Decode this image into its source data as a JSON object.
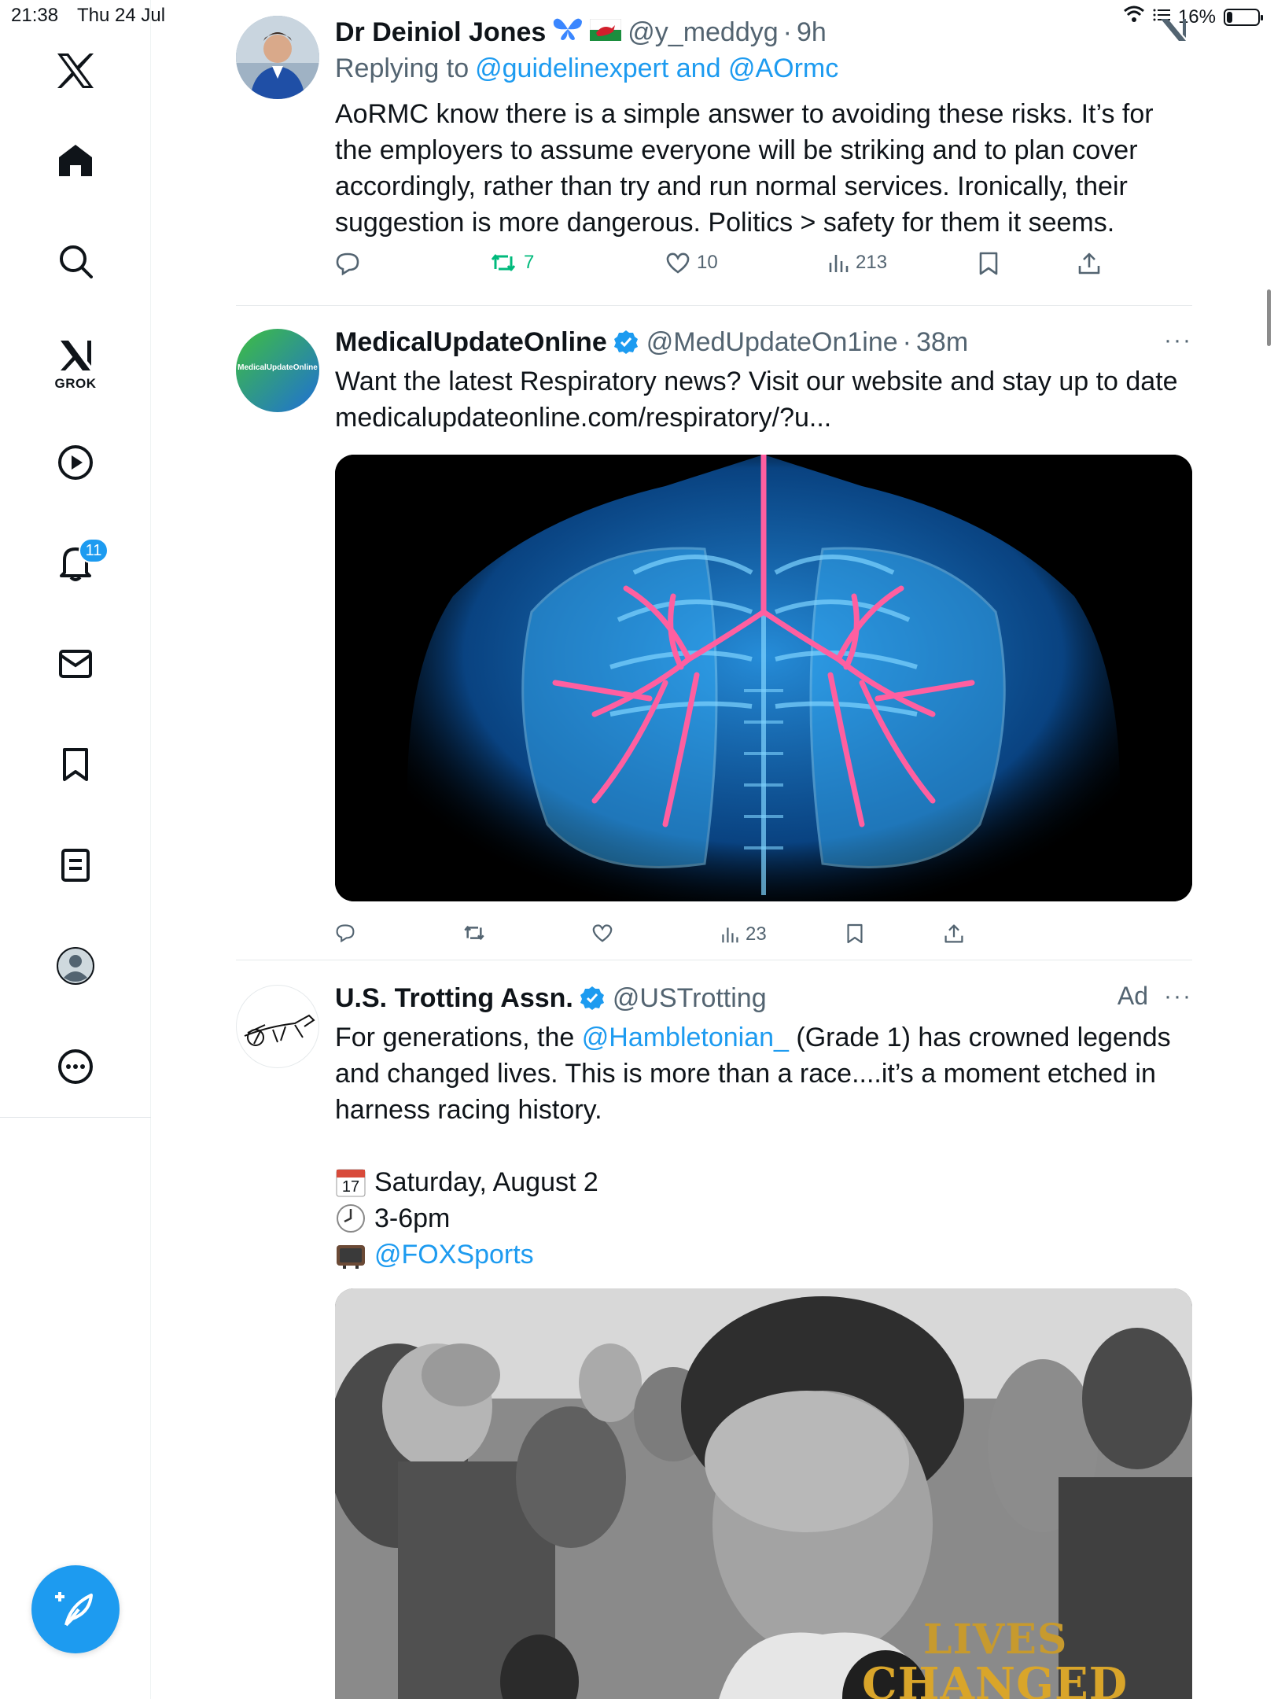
{
  "status_bar": {
    "time": "21:38",
    "date": "Thu 24 Jul",
    "battery": "16%",
    "battery_level": 0.16
  },
  "sidebar": {
    "grok_label": "GROK",
    "notification_count": "11",
    "items": [
      "home",
      "explore",
      "grok",
      "video",
      "notifications",
      "messages",
      "bookmarks",
      "lists",
      "profile",
      "more"
    ]
  },
  "tweets": [
    {
      "name": "Dr Deiniol Jones",
      "handle": "@y_meddyg",
      "time": "9h",
      "replying_prefix": "Replying to",
      "replying_to": "@guidelinexpert and @AOrmc",
      "lines": [
        "AoRMC know there is a simple answer to avoiding these risks. It’s for",
        "the employers to assume everyone will be striking and to plan cover",
        "accordingly, rather than try and run normal services. Ironically, their",
        "suggestion is more dangerous. Politics > safety  for them it seems."
      ],
      "retweets": "7",
      "likes": "10",
      "views": "213"
    },
    {
      "name": "MedicalUpdateOnline",
      "handle": "@MedUpdateOn1ine",
      "time": "38m",
      "avatar_text": "MedicalUpdateOnline",
      "text": "Want the latest Respiratory news? Visit our website and stay up to date",
      "url": "medicalupdateonline.com/respiratory/?u...",
      "views": "23"
    },
    {
      "name": "U.S. Trotting Assn.",
      "handle": "@USTrotting",
      "ad_label": "Ad",
      "text_prefix": "For generations, the ",
      "mention": "@Hambletonian_",
      "text_suffix": " (Grade 1) has crowned legends",
      "lines": [
        "and changed lives. This is more than a race....it’s a moment etched in",
        "harness racing history."
      ],
      "calendar_day": "17",
      "event_date": "Saturday, August 2",
      "event_time": "3-6pm",
      "event_channel": "@FOXSports",
      "overlay_text_1": "LIVES",
      "overlay_text_2": "CHANGED"
    }
  ]
}
